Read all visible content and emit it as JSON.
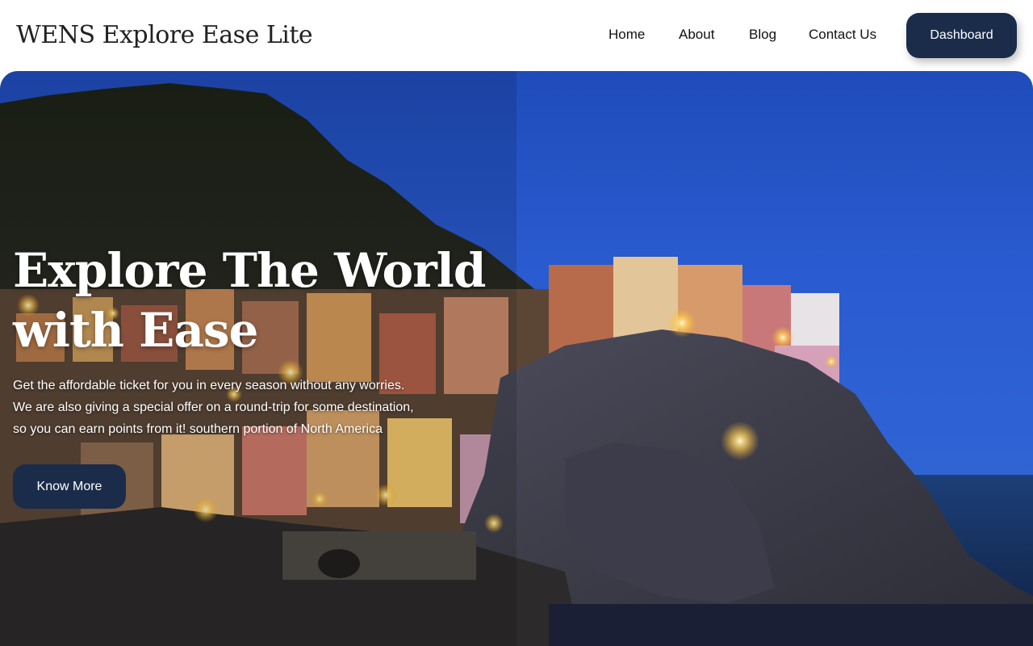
{
  "header": {
    "brand": "WENS Explore Ease Lite",
    "nav": [
      {
        "label": "Home"
      },
      {
        "label": "About"
      },
      {
        "label": "Blog"
      },
      {
        "label": "Contact Us"
      }
    ],
    "dashboard_label": "Dashboard"
  },
  "hero": {
    "title_line1": "Explore The World",
    "title_line2": "with Ease",
    "text_line1": "Get the affordable ticket for you in every season without any worries.",
    "text_line2": "We are also giving a special offer on a round-trip for some destination,",
    "text_line3": "so you can earn points from it! southern portion of North America",
    "button_label": "Know More",
    "background_image": "coastal-village-at-night"
  },
  "colors": {
    "primary_button": "#1b2c4b",
    "sky": "#2a5bd0",
    "header_bg": "#ffffff"
  }
}
